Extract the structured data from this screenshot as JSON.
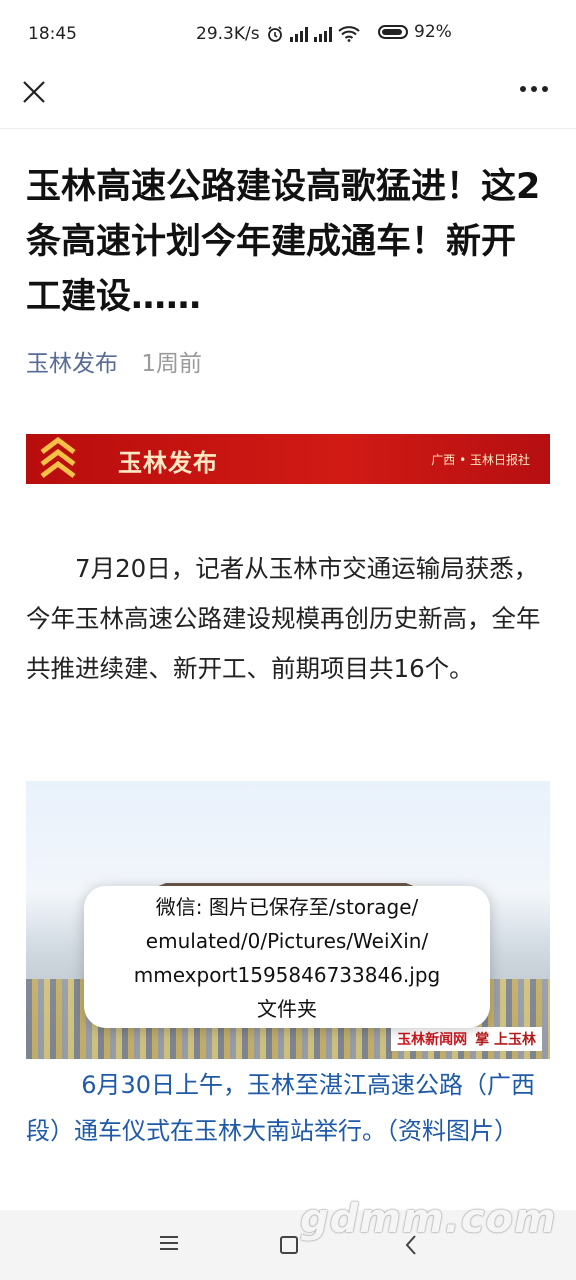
{
  "status": {
    "time": "18:45",
    "speed": "29.3K/s",
    "battery": "92%"
  },
  "article": {
    "title": "玉林高速公路建设高歌猛进！这2条高速计划今年建成通车！新开工建设……",
    "author": "玉林发布",
    "time_ago": "1周前",
    "banner_name": "玉林发布",
    "banner_source": "广西 • 玉林日报社",
    "paragraph": "7月20日，记者从玉林市交通运输局获悉，今年玉林高速公路建设规模再创历史新高，全年共推进续建、新开工、前期项目共16个。",
    "photo_watermark_1": "玉林新闻网",
    "photo_watermark_2": "掌 上玉林",
    "caption": "6月30日上午，玉林至湛江高速公路（广西段）通车仪式在玉林大南站举行。（资料图片）"
  },
  "toast": {
    "line1": "微信: 图片已保存至/storage/",
    "line2": "emulated/0/Pictures/WeiXin/",
    "line3": "mmexport1595846733846.jpg",
    "line4": "文件夹"
  },
  "watermark": "gdmm.com",
  "icons": {
    "close": "close-icon",
    "more": "more-icon",
    "alarm": "alarm-icon",
    "wifi": "wifi-icon",
    "battery": "battery-icon"
  },
  "colors": {
    "author_link": "#576b95",
    "caption_text": "#1e5aa8",
    "banner_red": "#d11a14"
  }
}
